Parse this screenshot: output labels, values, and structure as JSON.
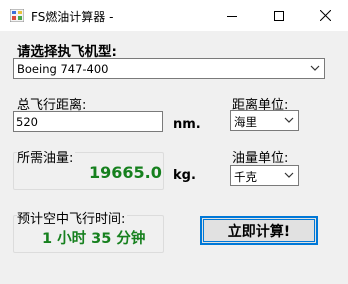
{
  "window": {
    "title": "FS燃油计算器 -",
    "icon": "app-icon",
    "controls": [
      "minimize-icon",
      "maximize-icon",
      "close-icon"
    ]
  },
  "aircraft": {
    "label": "请选择执飞机型:",
    "selected": "Boeing 747-400"
  },
  "distance": {
    "label": "总飞行距离:",
    "value": "520",
    "unit_abbr": "nm.",
    "unit_label": "距离单位:",
    "unit_selected": "海里"
  },
  "fuel": {
    "label": "所需油量:",
    "value": "19665.0",
    "unit_abbr": "kg.",
    "unit_label": "油量单位:",
    "unit_selected": "千克"
  },
  "flight_time": {
    "label": "预计空中飞行时间:",
    "value": "1 小时 35 分钟"
  },
  "actions": {
    "calculate_label": "立即计算!"
  },
  "colors": {
    "result_green": "#16801e",
    "focus_blue": "#0078d7"
  }
}
